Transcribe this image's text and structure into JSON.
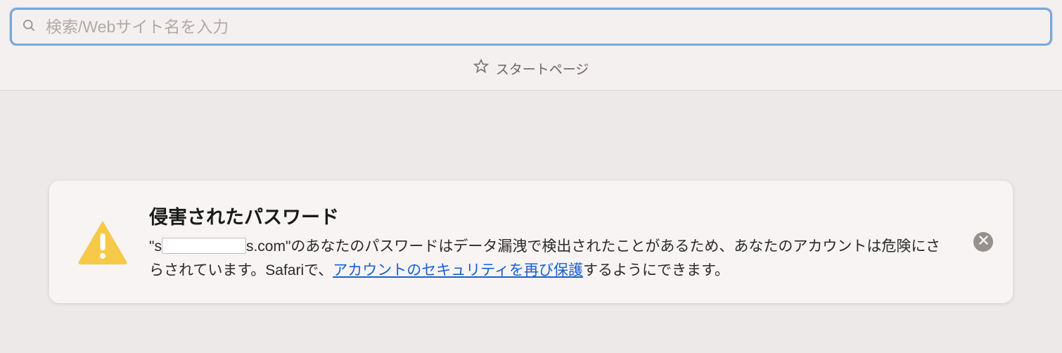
{
  "address_bar": {
    "placeholder": "検索/Webサイト名を入力",
    "value": ""
  },
  "tab": {
    "label": "スタートページ"
  },
  "banner": {
    "title": "侵害されたパスワード",
    "body_prefix": "\"s",
    "body_after_redact": "s.com\"のあなたのパスワードはデータ漏洩で検出されたことがあるため、あなたのアカウントは危険にさらされています。Safariで、",
    "link_text": "アカウントのセキュリティを再び保護",
    "body_suffix": "するようにできます。"
  }
}
